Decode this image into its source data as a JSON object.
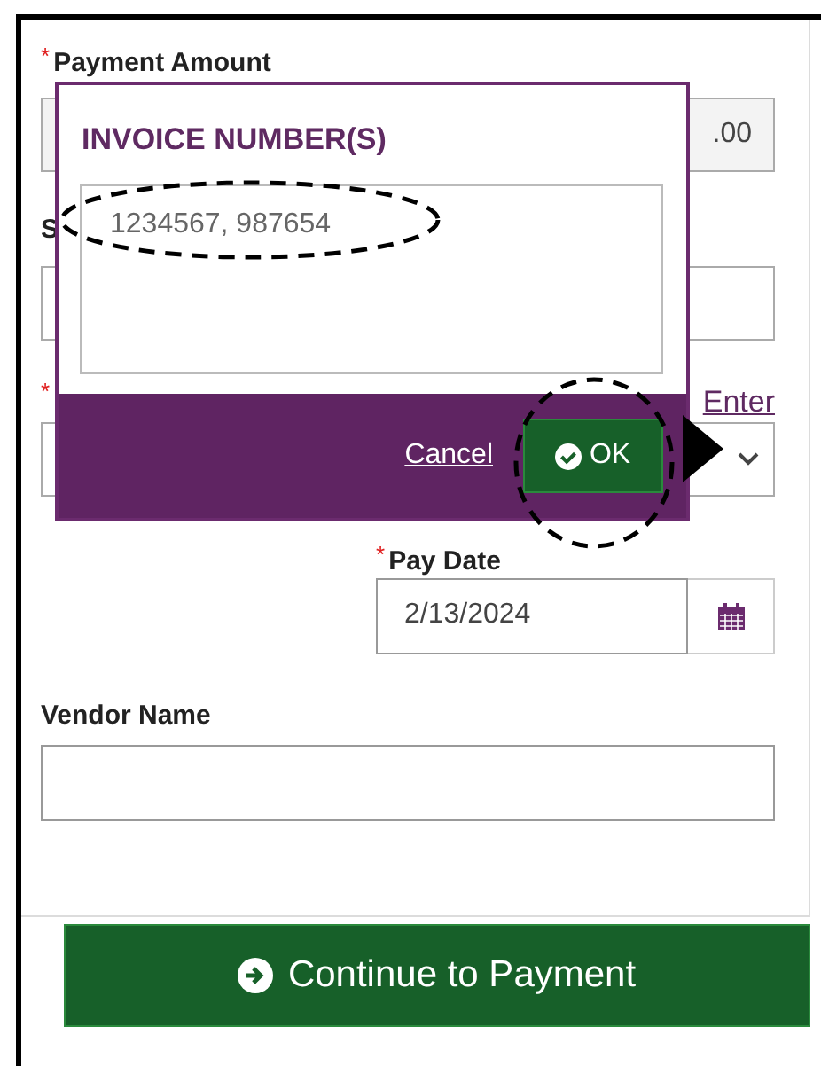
{
  "form": {
    "payment_amount": {
      "required_mark": "*",
      "label": "Payment Amount",
      "value": ".00"
    },
    "field_2": {
      "label": "S"
    },
    "field_3": {
      "required_mark": "*",
      "link": "Enter"
    },
    "pay_date": {
      "required_mark": "*",
      "label": "Pay Date",
      "value": "2/13/2024"
    },
    "vendor_name": {
      "label": "Vendor Name"
    }
  },
  "popup": {
    "title": "INVOICE NUMBER(S)",
    "value": "1234567, 987654",
    "cancel": "Cancel",
    "ok": "OK"
  },
  "continue_button": "Continue to Payment"
}
